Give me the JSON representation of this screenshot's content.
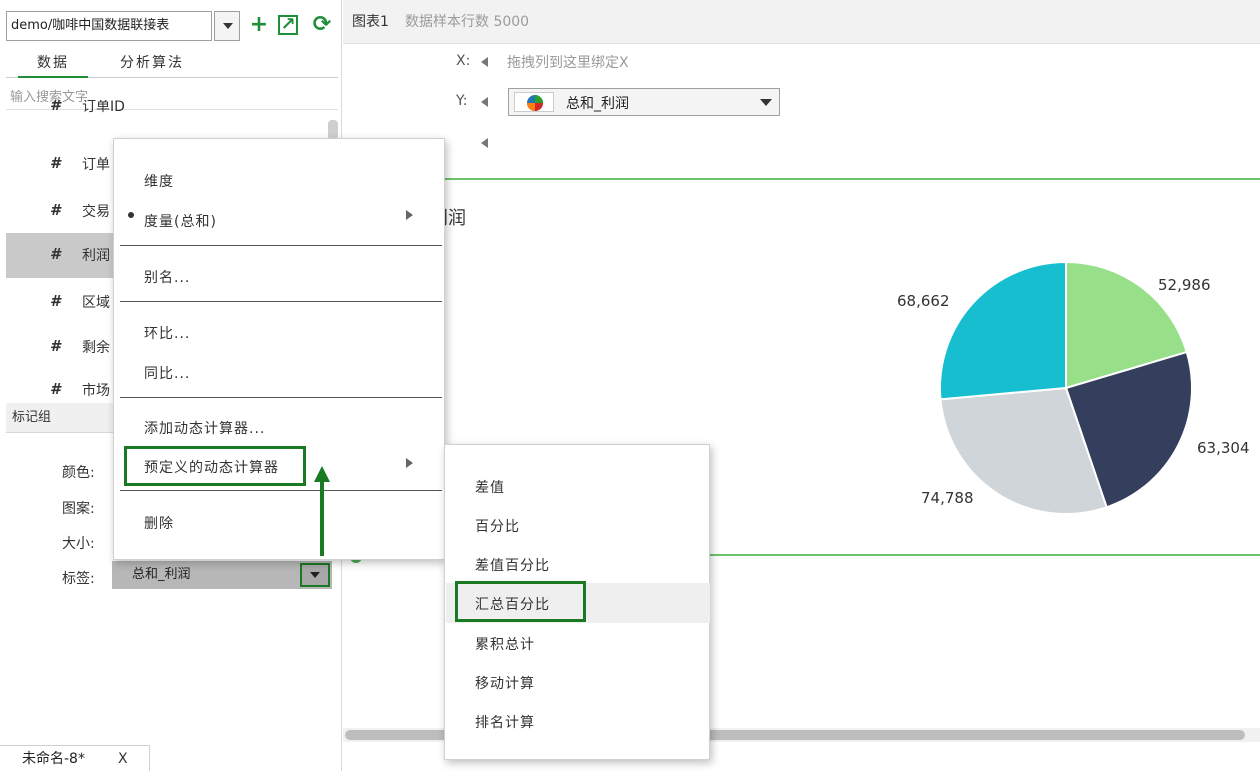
{
  "toolbar": {
    "datasource": "demo/咖啡中国数据联接表",
    "add_icon": "+",
    "open_icon": "↗",
    "refresh_icon": "⟳"
  },
  "tabs": {
    "data": "数据",
    "algo": "分析算法"
  },
  "search_placeholder": "输入搜索文字",
  "fields": [
    {
      "name": "订单ID"
    },
    {
      "name": "订单"
    },
    {
      "name": "交易"
    },
    {
      "name": "利润"
    },
    {
      "name": "区域"
    },
    {
      "name": "剩余"
    },
    {
      "name": "市场"
    }
  ],
  "mark_group": {
    "title": "标记组",
    "color": "颜色:",
    "pattern": "图案:",
    "size": "大小:",
    "label": "标签:",
    "label_value": "总和_利润"
  },
  "chart_header": {
    "title": "图表1",
    "sample": "数据样本行数 5000"
  },
  "axes": {
    "x_label": "X:",
    "x_placeholder": "拖拽列到这里绑定X",
    "y_label": "Y:",
    "y_value": "总和_利润"
  },
  "chart_title": "利润",
  "context_menu": {
    "dimension": "维度",
    "measure": "度量(总和)",
    "alias": "别名...",
    "mom": "环比...",
    "yoy": "同比...",
    "add_calc": "添加动态计算器...",
    "predefined": "预定义的动态计算器",
    "delete": "删除"
  },
  "sub_menu": {
    "diff": "差值",
    "pct": "百分比",
    "diff_pct": "差值百分比",
    "total_pct": "汇总百分比",
    "cumulative": "累积总计",
    "moving": "移动计算",
    "rank": "排名计算"
  },
  "bottom_tab": {
    "name": "未命名-8*",
    "close": "X"
  },
  "chart_data": {
    "type": "pie",
    "title": "利润",
    "values": [
      52986,
      63304,
      74788,
      68662
    ],
    "labels": [
      "52,986",
      "63,304",
      "74,788",
      "68,662"
    ],
    "colors": [
      "#98df8a",
      "#343f5e",
      "#d0d5d9",
      "#17becf"
    ]
  }
}
